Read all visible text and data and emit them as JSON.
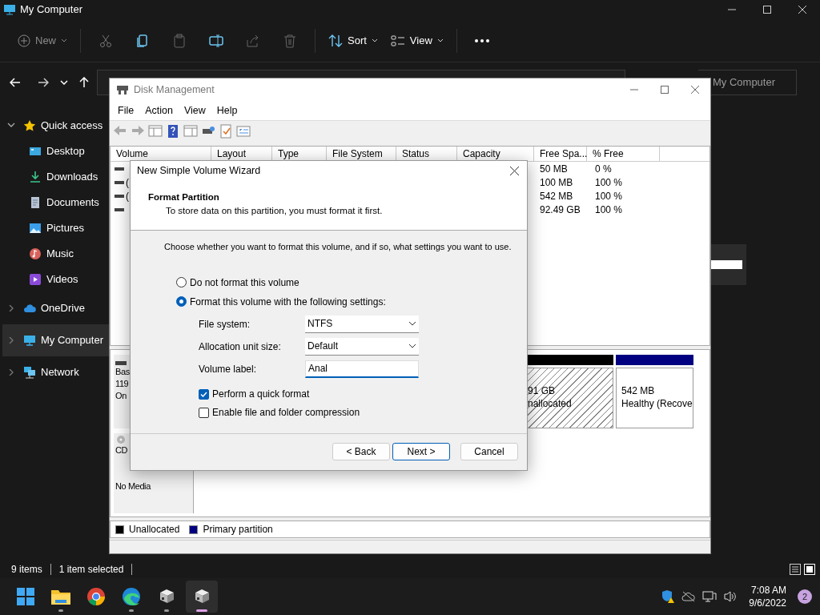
{
  "explorer": {
    "title": "My Computer",
    "toolbar": {
      "new": "New",
      "sort": "Sort",
      "view": "View"
    },
    "search": {
      "placeholder": "My Computer"
    },
    "sidebar": [
      {
        "label": "Quick access",
        "kind": "star",
        "expanded": true,
        "selected": false,
        "children": [
          {
            "label": "Desktop",
            "kind": "desktop",
            "selected": false
          },
          {
            "label": "Downloads",
            "kind": "download",
            "selected": false
          },
          {
            "label": "Documents",
            "kind": "document",
            "selected": false
          },
          {
            "label": "Pictures",
            "kind": "picture",
            "selected": false
          },
          {
            "label": "Music",
            "kind": "music",
            "selected": false
          },
          {
            "label": "Videos",
            "kind": "video",
            "selected": false
          }
        ]
      },
      {
        "label": "OneDrive",
        "kind": "cloud",
        "expanded": false,
        "selected": false
      },
      {
        "label": "My Computer",
        "kind": "computer",
        "expanded": false,
        "selected": true
      },
      {
        "label": "Network",
        "kind": "network",
        "expanded": false,
        "selected": false
      }
    ],
    "status_bar": {
      "items": "9 items",
      "selection": "1 item selected"
    }
  },
  "disk_management": {
    "title": "Disk Management",
    "menu": [
      "File",
      "Action",
      "View",
      "Help"
    ],
    "columns": [
      "Volume",
      "Layout",
      "Type",
      "File System",
      "Status",
      "Capacity",
      "Free Spa...",
      "% Free"
    ],
    "rows": [
      {
        "free": "50 MB",
        "pct_free": "0 %"
      },
      {
        "volume": "(",
        "free": "100 MB",
        "pct_free": "100 %"
      },
      {
        "volume": "(",
        "free": "542 MB",
        "pct_free": "100 %"
      },
      {
        "free": "92.49 GB",
        "pct_free": "100 %"
      }
    ],
    "disks": [
      {
        "kind": "basic",
        "lines": [
          "Bas",
          "119",
          "On"
        ],
        "partitions": [
          {
            "kind": "unallocated",
            "color": "#000000",
            "lines": [
              "91 GB",
              "nallocated"
            ]
          },
          {
            "kind": "primary",
            "color": "#000080",
            "lines": [
              "542 MB",
              "Healthy (Recove"
            ]
          }
        ]
      },
      {
        "kind": "cdrom",
        "lines": [
          "CD",
          "No Media"
        ]
      }
    ],
    "legend": [
      {
        "label": "Unallocated",
        "color": "#000000"
      },
      {
        "label": "Primary partition",
        "color": "#000080"
      }
    ]
  },
  "wizard": {
    "title": "New Simple Volume Wizard",
    "heading": "Format Partition",
    "subheading": "To store data on this partition, you must format it first.",
    "instruction": "Choose whether you want to format this volume, and if so, what settings you want to use.",
    "options": [
      {
        "label": "Do not format this volume",
        "selected": false
      },
      {
        "label": "Format this volume with the following settings:",
        "selected": true
      }
    ],
    "fields": [
      {
        "kind": "select",
        "label": "File system:",
        "value": "NTFS"
      },
      {
        "kind": "select",
        "label": "Allocation unit size:",
        "value": "Default"
      },
      {
        "kind": "text",
        "label": "Volume label:",
        "value": "Anal"
      }
    ],
    "checkboxes": [
      {
        "label": "Perform a quick format",
        "checked": true
      },
      {
        "label": "Enable file and folder compression",
        "checked": false
      }
    ],
    "buttons": [
      {
        "label": "< Back",
        "default": false
      },
      {
        "label": "Next >",
        "default": true
      },
      {
        "label": "Cancel",
        "default": false
      }
    ]
  },
  "taskbar": {
    "apps": [
      {
        "kind": "start",
        "running": false,
        "selected": false
      },
      {
        "kind": "folder",
        "running": true,
        "selected": false
      },
      {
        "kind": "chrome",
        "running": false,
        "selected": false
      },
      {
        "kind": "edge",
        "running": true,
        "selected": false
      },
      {
        "kind": "disk",
        "running": true,
        "selected": false
      },
      {
        "kind": "disk",
        "running": true,
        "selected": true
      }
    ],
    "time": "7:08 AM",
    "date": "9/6/2022",
    "notifications": "2"
  }
}
